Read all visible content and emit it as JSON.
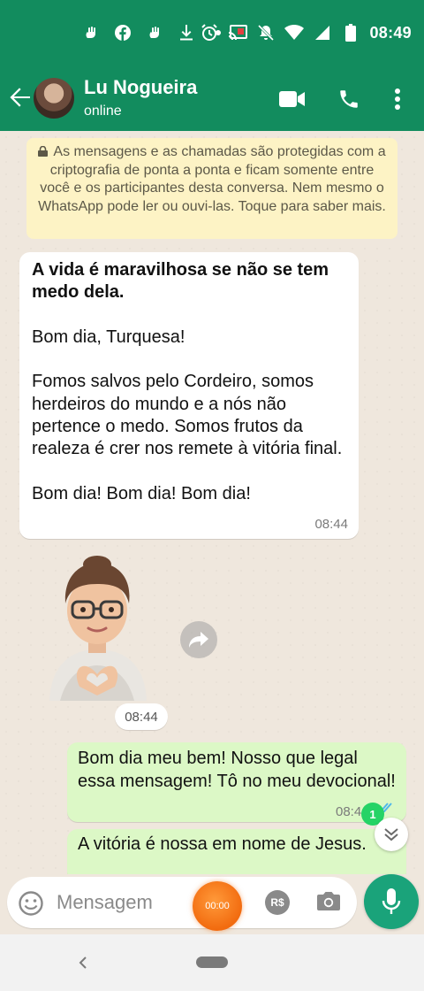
{
  "status_bar": {
    "time": "08:49",
    "left_icons": [
      "hand-icon",
      "facebook-icon",
      "hand-icon",
      "download-icon",
      "dot-icon"
    ],
    "right_icons": [
      "alarm-icon",
      "cast-icon",
      "muted-bell-icon",
      "wifi-icon",
      "signal-icon",
      "battery-icon"
    ]
  },
  "header": {
    "contact_name": "Lu Nogueira",
    "status": "online"
  },
  "encryption_notice": "As mensagens e as chamadas são protegidas com a criptografia de ponta a ponta e ficam somente entre você e os participantes desta conversa. Nem mesmo o WhatsApp pode ler ou ouvi-las. Toque para saber mais.",
  "messages": [
    {
      "direction": "incoming",
      "title": "A vida é maravilhosa se não se tem medo dela.",
      "paragraphs": [
        "Bom dia, Turquesa!",
        "Fomos salvos pelo Cordeiro, somos herdeiros do mundo e a nós não pertence o medo. Somos frutos da realeza é crer nos remete à vitória final.",
        "Bom dia! Bom dia! Bom dia!"
      ],
      "time": "08:44"
    },
    {
      "direction": "incoming",
      "type": "sticker",
      "time": "08:44"
    },
    {
      "direction": "outgoing",
      "text": "Bom dia meu bem! Nosso que legal essa mensagem! Tô no meu devocional!",
      "time": "08:4"
    },
    {
      "direction": "outgoing",
      "text": "A vitória é nossa em nome de Jesus."
    }
  ],
  "unread_badge": "1",
  "input": {
    "placeholder": "Mensagem",
    "recording_timer": "00:00",
    "currency_label": "R$"
  },
  "colors": {
    "header_green": "#128c5e",
    "outgoing_bubble": "#dcf8c6",
    "notice_yellow": "#fdf3c5",
    "mic_green": "#1aa37a",
    "recording_orange": "#f26b0f"
  }
}
